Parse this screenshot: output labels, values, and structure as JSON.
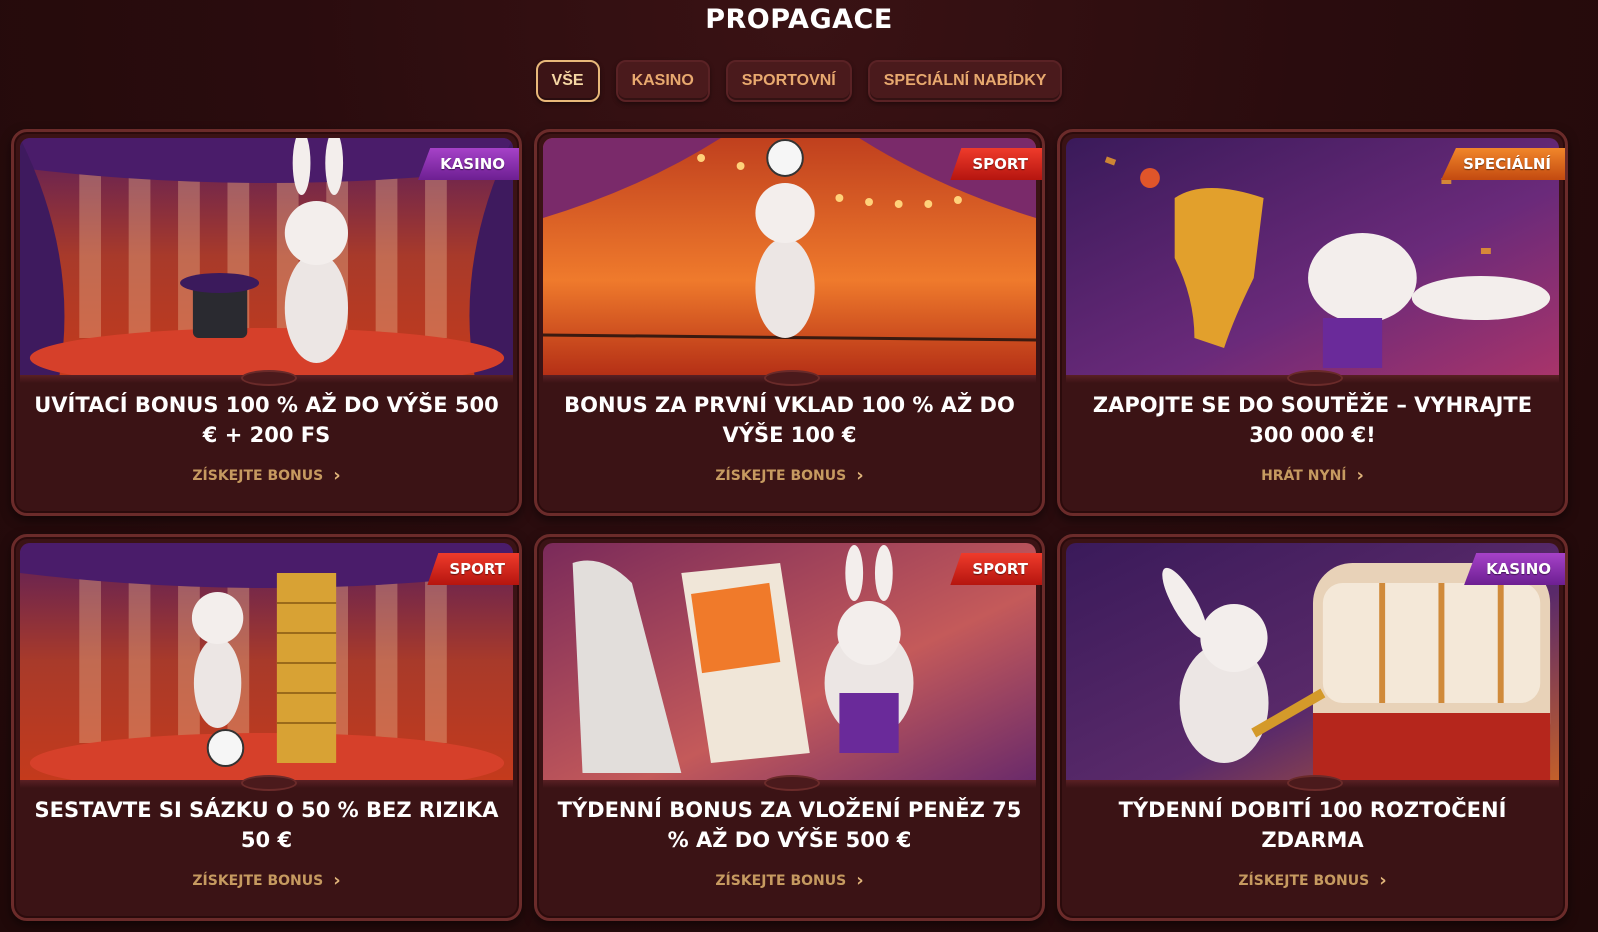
{
  "page": {
    "title": "PROPAGACE"
  },
  "tabs": [
    {
      "label": "VŠE",
      "active": true
    },
    {
      "label": "KASINO",
      "active": false
    },
    {
      "label": "SPORTOVNÍ",
      "active": false
    },
    {
      "label": "SPECIÁLNÍ NABÍDKY",
      "active": false
    }
  ],
  "cards": [
    {
      "badge": "KASINO",
      "badge_type": "casino",
      "title": "UVÍTACÍ BONUS 100 % AŽ DO VÝŠE 500 € + 200 FS",
      "cta": "ZÍSKEJTE BONUS",
      "icon": "rabbit-magician-hat-icon"
    },
    {
      "badge": "SPORT",
      "badge_type": "sport",
      "title": "BONUS ZA PRVNÍ VKLAD 100 % AŽ DO VÝŠE 100 €",
      "cta": "ZÍSKEJTE BONUS",
      "icon": "rabbit-tightrope-ball-icon"
    },
    {
      "badge": "SPECIÁLNÍ",
      "badge_type": "special",
      "title": "ZAPOJTE SE DO SOUTĚŽE – VYHRAJTE 300 000 €!",
      "cta": "HRÁT NYNÍ",
      "icon": "rabbit-trophy-icon"
    },
    {
      "badge": "SPORT",
      "badge_type": "sport",
      "title": "SESTAVTE SI SÁZKU O 50 % BEZ RIZIKA 50 €",
      "cta": "ZÍSKEJTE BONUS",
      "icon": "rabbit-gold-tower-icon"
    },
    {
      "badge": "SPORT",
      "badge_type": "sport",
      "title": "TÝDENNÍ BONUS ZA VLOŽENÍ PENĚZ 75 % AŽ DO VÝŠE 500 €",
      "cta": "ZÍSKEJTE BONUS",
      "icon": "rabbit-newspaper-icon"
    },
    {
      "badge": "KASINO",
      "badge_type": "casino",
      "title": "TÝDENNÍ DOBITÍ 100 ROZTOČENÍ ZDARMA",
      "cta": "ZÍSKEJTE BONUS",
      "icon": "rabbit-slot-machine-icon"
    }
  ],
  "colors": {
    "accent": "#e8b87a",
    "card_bg": "#3b1315",
    "cta": "#c69a60"
  }
}
